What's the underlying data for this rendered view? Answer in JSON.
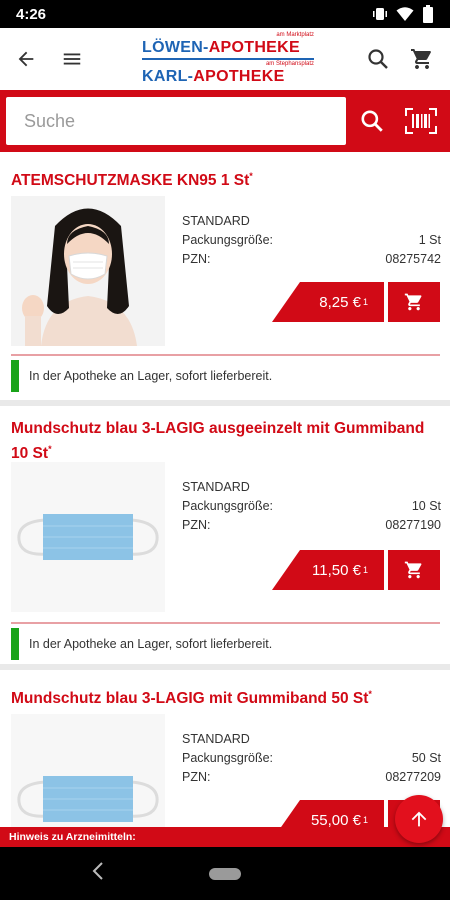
{
  "status_bar": {
    "time": "4:26"
  },
  "header": {
    "logo": {
      "small_top": "am Marktplatz",
      "line1_part1": "LÖWEN-",
      "line1_part2": "APOTHEKE",
      "small_bottom": "am Stephansplatz",
      "line2_part1": "KARL-",
      "line2_part2": "APOTHEKE"
    },
    "icons": {
      "back": "arrow-left-icon",
      "menu": "hamburger-icon",
      "search": "search-icon",
      "cart": "cart-icon"
    }
  },
  "search": {
    "placeholder": "Suche",
    "value": ""
  },
  "detail_labels": {
    "variant": "STANDARD",
    "pack_size": "Packungsgröße:",
    "pzn": "PZN:"
  },
  "products": [
    {
      "title": "ATEMSCHUTZMASKE KN95 1 St",
      "title_mark": "*",
      "pack_size": "1 St",
      "pzn": "08275742",
      "price": "8,25 €",
      "price_mark": "1",
      "stock": "In der Apotheke an Lager, sofort lieferbereit."
    },
    {
      "title": "Mundschutz blau 3-LAGIG ausgeeinzelt mit Gummiband 10 St",
      "title_mark": "*",
      "pack_size": "10 St",
      "pzn": "08277190",
      "price": "11,50 €",
      "price_mark": "1",
      "stock": "In der Apotheke an Lager, sofort lieferbereit."
    },
    {
      "title": "Mundschutz blau 3-LAGIG mit Gummiband 50 St",
      "title_mark": "*",
      "pack_size": "50 St",
      "pzn": "08277209",
      "price": "55,00 €",
      "price_mark": "1",
      "stock": ""
    }
  ],
  "hint_bar": {
    "text": "Hinweis zu Arzneimitteln:"
  },
  "colors": {
    "brand_red": "#d10a16",
    "logo_blue": "#1e64b4",
    "stock_green": "#19a319"
  }
}
